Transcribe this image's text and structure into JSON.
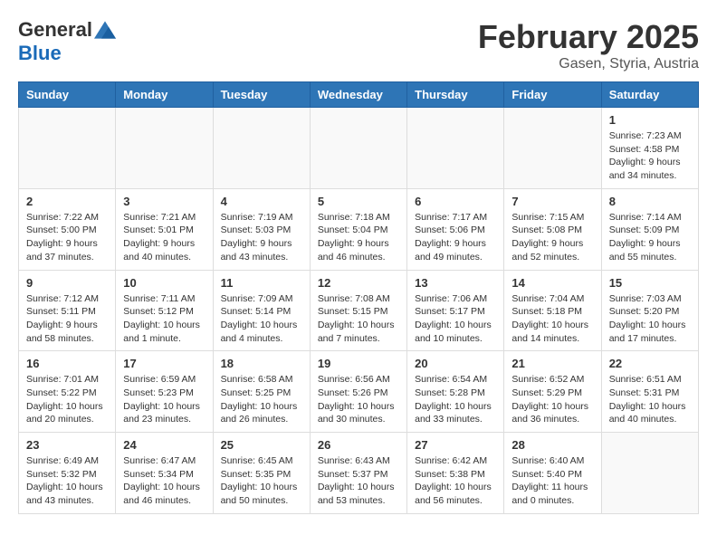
{
  "logo": {
    "general": "General",
    "blue": "Blue"
  },
  "title": {
    "month_year": "February 2025",
    "location": "Gasen, Styria, Austria"
  },
  "days_of_week": [
    "Sunday",
    "Monday",
    "Tuesday",
    "Wednesday",
    "Thursday",
    "Friday",
    "Saturday"
  ],
  "weeks": [
    [
      {
        "day": "",
        "info": ""
      },
      {
        "day": "",
        "info": ""
      },
      {
        "day": "",
        "info": ""
      },
      {
        "day": "",
        "info": ""
      },
      {
        "day": "",
        "info": ""
      },
      {
        "day": "",
        "info": ""
      },
      {
        "day": "1",
        "info": "Sunrise: 7:23 AM\nSunset: 4:58 PM\nDaylight: 9 hours\nand 34 minutes."
      }
    ],
    [
      {
        "day": "2",
        "info": "Sunrise: 7:22 AM\nSunset: 5:00 PM\nDaylight: 9 hours\nand 37 minutes."
      },
      {
        "day": "3",
        "info": "Sunrise: 7:21 AM\nSunset: 5:01 PM\nDaylight: 9 hours\nand 40 minutes."
      },
      {
        "day": "4",
        "info": "Sunrise: 7:19 AM\nSunset: 5:03 PM\nDaylight: 9 hours\nand 43 minutes."
      },
      {
        "day": "5",
        "info": "Sunrise: 7:18 AM\nSunset: 5:04 PM\nDaylight: 9 hours\nand 46 minutes."
      },
      {
        "day": "6",
        "info": "Sunrise: 7:17 AM\nSunset: 5:06 PM\nDaylight: 9 hours\nand 49 minutes."
      },
      {
        "day": "7",
        "info": "Sunrise: 7:15 AM\nSunset: 5:08 PM\nDaylight: 9 hours\nand 52 minutes."
      },
      {
        "day": "8",
        "info": "Sunrise: 7:14 AM\nSunset: 5:09 PM\nDaylight: 9 hours\nand 55 minutes."
      }
    ],
    [
      {
        "day": "9",
        "info": "Sunrise: 7:12 AM\nSunset: 5:11 PM\nDaylight: 9 hours\nand 58 minutes."
      },
      {
        "day": "10",
        "info": "Sunrise: 7:11 AM\nSunset: 5:12 PM\nDaylight: 10 hours\nand 1 minute."
      },
      {
        "day": "11",
        "info": "Sunrise: 7:09 AM\nSunset: 5:14 PM\nDaylight: 10 hours\nand 4 minutes."
      },
      {
        "day": "12",
        "info": "Sunrise: 7:08 AM\nSunset: 5:15 PM\nDaylight: 10 hours\nand 7 minutes."
      },
      {
        "day": "13",
        "info": "Sunrise: 7:06 AM\nSunset: 5:17 PM\nDaylight: 10 hours\nand 10 minutes."
      },
      {
        "day": "14",
        "info": "Sunrise: 7:04 AM\nSunset: 5:18 PM\nDaylight: 10 hours\nand 14 minutes."
      },
      {
        "day": "15",
        "info": "Sunrise: 7:03 AM\nSunset: 5:20 PM\nDaylight: 10 hours\nand 17 minutes."
      }
    ],
    [
      {
        "day": "16",
        "info": "Sunrise: 7:01 AM\nSunset: 5:22 PM\nDaylight: 10 hours\nand 20 minutes."
      },
      {
        "day": "17",
        "info": "Sunrise: 6:59 AM\nSunset: 5:23 PM\nDaylight: 10 hours\nand 23 minutes."
      },
      {
        "day": "18",
        "info": "Sunrise: 6:58 AM\nSunset: 5:25 PM\nDaylight: 10 hours\nand 26 minutes."
      },
      {
        "day": "19",
        "info": "Sunrise: 6:56 AM\nSunset: 5:26 PM\nDaylight: 10 hours\nand 30 minutes."
      },
      {
        "day": "20",
        "info": "Sunrise: 6:54 AM\nSunset: 5:28 PM\nDaylight: 10 hours\nand 33 minutes."
      },
      {
        "day": "21",
        "info": "Sunrise: 6:52 AM\nSunset: 5:29 PM\nDaylight: 10 hours\nand 36 minutes."
      },
      {
        "day": "22",
        "info": "Sunrise: 6:51 AM\nSunset: 5:31 PM\nDaylight: 10 hours\nand 40 minutes."
      }
    ],
    [
      {
        "day": "23",
        "info": "Sunrise: 6:49 AM\nSunset: 5:32 PM\nDaylight: 10 hours\nand 43 minutes."
      },
      {
        "day": "24",
        "info": "Sunrise: 6:47 AM\nSunset: 5:34 PM\nDaylight: 10 hours\nand 46 minutes."
      },
      {
        "day": "25",
        "info": "Sunrise: 6:45 AM\nSunset: 5:35 PM\nDaylight: 10 hours\nand 50 minutes."
      },
      {
        "day": "26",
        "info": "Sunrise: 6:43 AM\nSunset: 5:37 PM\nDaylight: 10 hours\nand 53 minutes."
      },
      {
        "day": "27",
        "info": "Sunrise: 6:42 AM\nSunset: 5:38 PM\nDaylight: 10 hours\nand 56 minutes."
      },
      {
        "day": "28",
        "info": "Sunrise: 6:40 AM\nSunset: 5:40 PM\nDaylight: 11 hours\nand 0 minutes."
      },
      {
        "day": "",
        "info": ""
      }
    ]
  ]
}
